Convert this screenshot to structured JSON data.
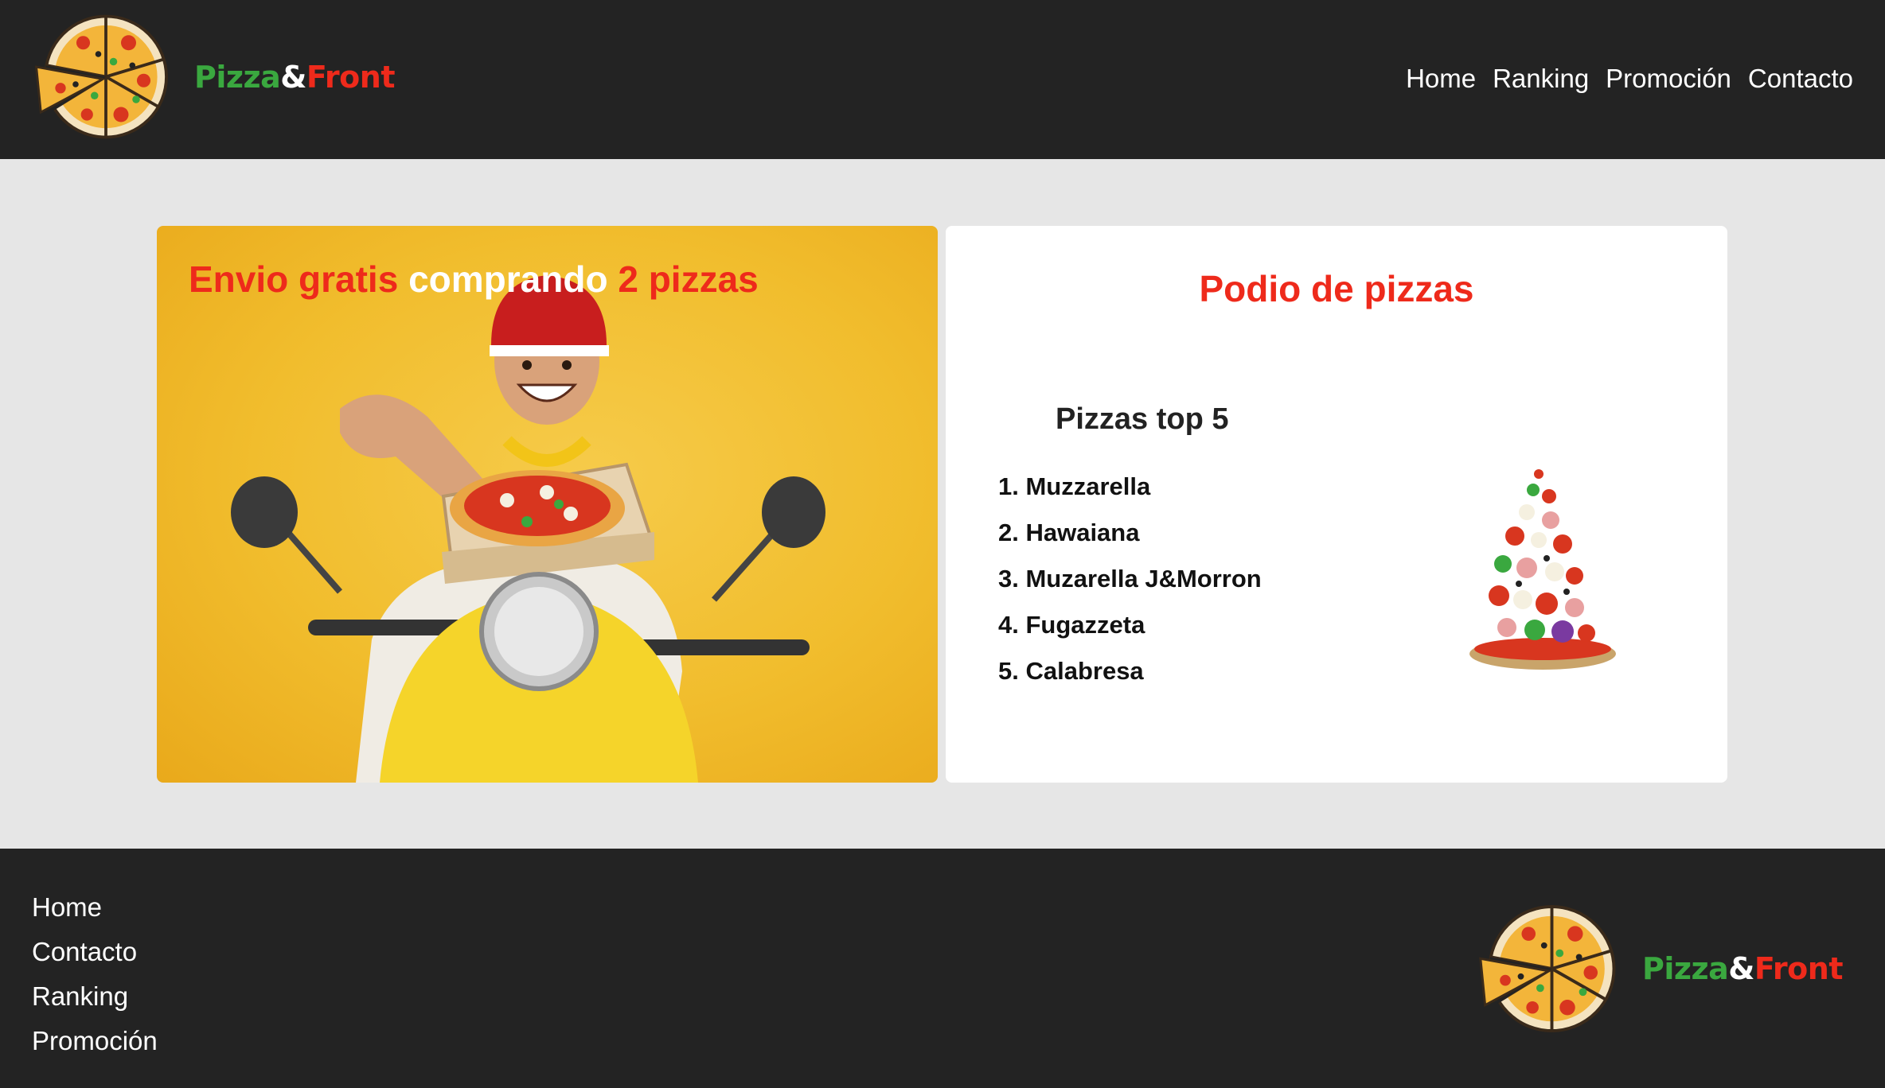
{
  "header": {
    "brand": {
      "part1": "Pizza",
      "part2": "&",
      "part3": "Front"
    },
    "nav": [
      "Home",
      "Ranking",
      "Promoción",
      "Contacto"
    ]
  },
  "promo": {
    "title_red1": "Envio gratis",
    "title_white": "comprando",
    "title_red2": "2 pizzas"
  },
  "podium": {
    "title": "Podio de pizzas",
    "list_title": "Pizzas top 5",
    "items": [
      "1. Muzzarella",
      "2. Hawaiana",
      "3. Muzarella J&Morron",
      "4. Fugazzeta",
      "5. Calabresa"
    ]
  },
  "footer": {
    "nav": [
      "Home",
      "Contacto",
      "Ranking",
      "Promoción"
    ],
    "brand": {
      "part1": "Pizza",
      "part2": "&",
      "part3": "Front"
    }
  },
  "colors": {
    "header_bg": "#232323",
    "page_bg": "#e6e6e6",
    "accent_red": "#ee2a1b",
    "brand_green": "#3aa83f",
    "promo_yellow": "#f1bd2d"
  },
  "icons": [
    "pizza-logo-icon",
    "pizza-tower-image",
    "delivery-man-image"
  ]
}
